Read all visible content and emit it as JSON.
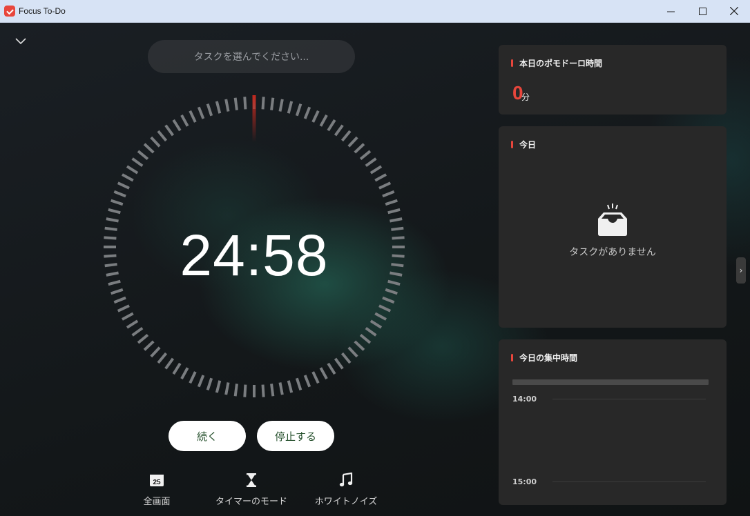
{
  "window": {
    "title": "Focus To-Do",
    "controls": {
      "minimize": "—",
      "maximize": "☐",
      "close": "✕"
    }
  },
  "task_selector": {
    "placeholder": "タスクを選んでください..."
  },
  "timer": {
    "display": "24:58",
    "progress_fraction": 0.01,
    "accent_color": "#c0281e"
  },
  "actions": {
    "continue_label": "続く",
    "stop_label": "停止する"
  },
  "bottom_tools": [
    {
      "label": "全画面",
      "icon": "calendar-icon",
      "badge": "25"
    },
    {
      "label": "タイマーのモード",
      "icon": "hourglass-icon"
    },
    {
      "label": "ホワイトノイズ",
      "icon": "music-note-icon"
    }
  ],
  "panels": {
    "pomodoro_today": {
      "title": "本日のポモドーロ時間",
      "value": "0",
      "unit": "分"
    },
    "today": {
      "title": "今日",
      "empty_text": "タスクがありません"
    },
    "focus_time": {
      "title": "今日の集中時間",
      "times": [
        "14:00",
        "15:00"
      ]
    }
  },
  "side_toggle": {
    "glyph": "›"
  },
  "colors": {
    "accent": "#e8463c",
    "panel_bg": "#282828",
    "button_text": "#244f2b"
  }
}
